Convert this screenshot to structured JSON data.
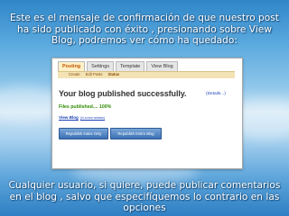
{
  "caption_top": "Este es el mensaje de confirmación de que nuestro post ha sido publicado con éxito , presionando sobre View Blog, podremos ver cómo ha quedado:",
  "caption_bottom": "Cualquier usuario, si quiere, puede publicar comentarios en el blog , salvo que especifíquemos lo contrario en las opciones",
  "screenshot": {
    "tabs": [
      "Posting",
      "Settings",
      "Template",
      "View Blog"
    ],
    "active_tab": "Posting",
    "subtabs": [
      "Create",
      "Edit Posts",
      "Status"
    ],
    "active_subtab": "Status",
    "title": "Your blog published successfully.",
    "details_link": "(Details...)",
    "files_published": "Files published.... 100%",
    "view_blog": "View Blog",
    "view_blog_sub": "(in a new window)",
    "btn_index": "Republish Index Only",
    "btn_entire": "Republish Entire Blog"
  }
}
